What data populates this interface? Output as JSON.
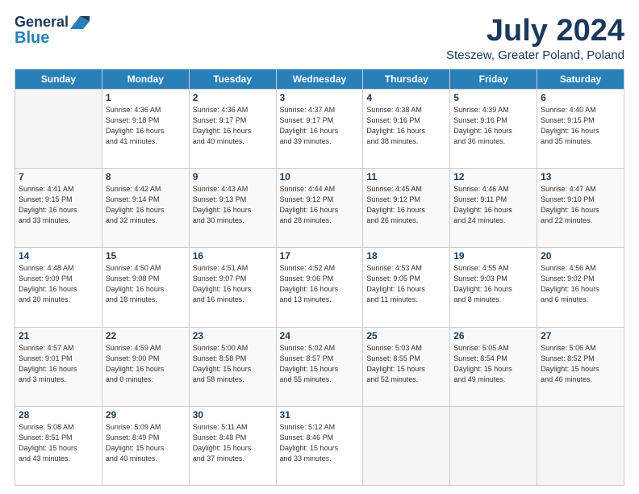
{
  "header": {
    "logo": {
      "line1": "General",
      "line2": "Blue"
    },
    "title": "July 2024",
    "location": "Steszew, Greater Poland, Poland"
  },
  "days_of_week": [
    "Sunday",
    "Monday",
    "Tuesday",
    "Wednesday",
    "Thursday",
    "Friday",
    "Saturday"
  ],
  "weeks": [
    [
      {
        "day": "",
        "info": ""
      },
      {
        "day": "1",
        "info": "Sunrise: 4:36 AM\nSunset: 9:18 PM\nDaylight: 16 hours\nand 41 minutes."
      },
      {
        "day": "2",
        "info": "Sunrise: 4:36 AM\nSunset: 9:17 PM\nDaylight: 16 hours\nand 40 minutes."
      },
      {
        "day": "3",
        "info": "Sunrise: 4:37 AM\nSunset: 9:17 PM\nDaylight: 16 hours\nand 39 minutes."
      },
      {
        "day": "4",
        "info": "Sunrise: 4:38 AM\nSunset: 9:16 PM\nDaylight: 16 hours\nand 38 minutes."
      },
      {
        "day": "5",
        "info": "Sunrise: 4:39 AM\nSunset: 9:16 PM\nDaylight: 16 hours\nand 36 minutes."
      },
      {
        "day": "6",
        "info": "Sunrise: 4:40 AM\nSunset: 9:15 PM\nDaylight: 16 hours\nand 35 minutes."
      }
    ],
    [
      {
        "day": "7",
        "info": "Sunrise: 4:41 AM\nSunset: 9:15 PM\nDaylight: 16 hours\nand 33 minutes."
      },
      {
        "day": "8",
        "info": "Sunrise: 4:42 AM\nSunset: 9:14 PM\nDaylight: 16 hours\nand 32 minutes."
      },
      {
        "day": "9",
        "info": "Sunrise: 4:43 AM\nSunset: 9:13 PM\nDaylight: 16 hours\nand 30 minutes."
      },
      {
        "day": "10",
        "info": "Sunrise: 4:44 AM\nSunset: 9:12 PM\nDaylight: 16 hours\nand 28 minutes."
      },
      {
        "day": "11",
        "info": "Sunrise: 4:45 AM\nSunset: 9:12 PM\nDaylight: 16 hours\nand 26 minutes."
      },
      {
        "day": "12",
        "info": "Sunrise: 4:46 AM\nSunset: 9:11 PM\nDaylight: 16 hours\nand 24 minutes."
      },
      {
        "day": "13",
        "info": "Sunrise: 4:47 AM\nSunset: 9:10 PM\nDaylight: 16 hours\nand 22 minutes."
      }
    ],
    [
      {
        "day": "14",
        "info": "Sunrise: 4:48 AM\nSunset: 9:09 PM\nDaylight: 16 hours\nand 20 minutes."
      },
      {
        "day": "15",
        "info": "Sunrise: 4:50 AM\nSunset: 9:08 PM\nDaylight: 16 hours\nand 18 minutes."
      },
      {
        "day": "16",
        "info": "Sunrise: 4:51 AM\nSunset: 9:07 PM\nDaylight: 16 hours\nand 16 minutes."
      },
      {
        "day": "17",
        "info": "Sunrise: 4:52 AM\nSunset: 9:06 PM\nDaylight: 16 hours\nand 13 minutes."
      },
      {
        "day": "18",
        "info": "Sunrise: 4:53 AM\nSunset: 9:05 PM\nDaylight: 16 hours\nand 11 minutes."
      },
      {
        "day": "19",
        "info": "Sunrise: 4:55 AM\nSunset: 9:03 PM\nDaylight: 16 hours\nand 8 minutes."
      },
      {
        "day": "20",
        "info": "Sunrise: 4:56 AM\nSunset: 9:02 PM\nDaylight: 16 hours\nand 6 minutes."
      }
    ],
    [
      {
        "day": "21",
        "info": "Sunrise: 4:57 AM\nSunset: 9:01 PM\nDaylight: 16 hours\nand 3 minutes."
      },
      {
        "day": "22",
        "info": "Sunrise: 4:59 AM\nSunset: 9:00 PM\nDaylight: 16 hours\nand 0 minutes."
      },
      {
        "day": "23",
        "info": "Sunrise: 5:00 AM\nSunset: 8:58 PM\nDaylight: 15 hours\nand 58 minutes."
      },
      {
        "day": "24",
        "info": "Sunrise: 5:02 AM\nSunset: 8:57 PM\nDaylight: 15 hours\nand 55 minutes."
      },
      {
        "day": "25",
        "info": "Sunrise: 5:03 AM\nSunset: 8:55 PM\nDaylight: 15 hours\nand 52 minutes."
      },
      {
        "day": "26",
        "info": "Sunrise: 5:05 AM\nSunset: 8:54 PM\nDaylight: 15 hours\nand 49 minutes."
      },
      {
        "day": "27",
        "info": "Sunrise: 5:06 AM\nSunset: 8:52 PM\nDaylight: 15 hours\nand 46 minutes."
      }
    ],
    [
      {
        "day": "28",
        "info": "Sunrise: 5:08 AM\nSunset: 8:51 PM\nDaylight: 15 hours\nand 43 minutes."
      },
      {
        "day": "29",
        "info": "Sunrise: 5:09 AM\nSunset: 8:49 PM\nDaylight: 15 hours\nand 40 minutes."
      },
      {
        "day": "30",
        "info": "Sunrise: 5:11 AM\nSunset: 8:48 PM\nDaylight: 15 hours\nand 37 minutes."
      },
      {
        "day": "31",
        "info": "Sunrise: 5:12 AM\nSunset: 8:46 PM\nDaylight: 15 hours\nand 33 minutes."
      },
      {
        "day": "",
        "info": ""
      },
      {
        "day": "",
        "info": ""
      },
      {
        "day": "",
        "info": ""
      }
    ]
  ]
}
